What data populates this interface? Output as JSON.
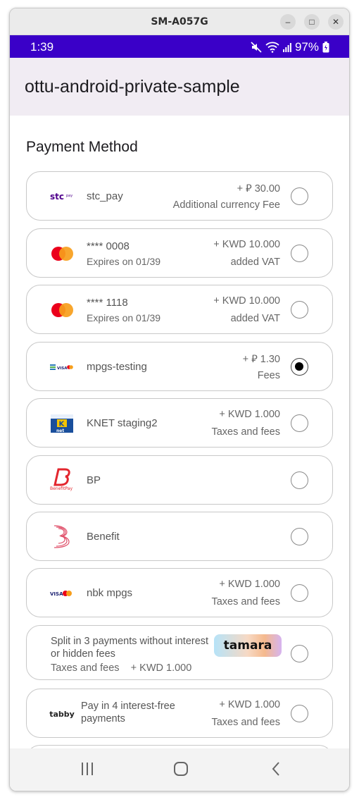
{
  "window": {
    "title": "SM-A057G",
    "minimize": "–",
    "maximize": "□",
    "close": "✕"
  },
  "status": {
    "time": "1:39",
    "battery": "97%"
  },
  "app": {
    "title": "ottu-android-private-sample"
  },
  "section_title": "Payment Method",
  "methods": [
    {
      "name": "stc_pay",
      "logo_text": "stc pay",
      "price": "+ ⃁ 30.00",
      "fee_label": "Additional currency Fee",
      "selected": false
    },
    {
      "name": "**** 0008",
      "sub": "Expires on 01/39",
      "price": "+ KWD 10.000",
      "fee_label": "added VAT",
      "selected": false
    },
    {
      "name": "**** 1118",
      "sub": "Expires on 01/39",
      "price": "+ KWD 10.000",
      "fee_label": "added VAT",
      "selected": false
    },
    {
      "name": "mpgs-testing",
      "logo_text": "VISA",
      "price": "+ ⃁ 1.30",
      "fee_label": "Fees",
      "selected": true
    },
    {
      "name": "KNET  staging2",
      "logo_text": "net",
      "price": "+ KWD 1.000",
      "fee_label": "Taxes and fees",
      "selected": false
    },
    {
      "name": "BP",
      "logo_text": "BenefitPay",
      "selected": false
    },
    {
      "name": "Benefit",
      "selected": false
    },
    {
      "name": "nbk mpgs",
      "logo_text": "VISA",
      "price": "+ KWD 1.000",
      "fee_label": "Taxes and fees",
      "selected": false
    },
    {
      "name_line1": "Split in 3 payments without interest",
      "name_line2": "or hidden fees",
      "fee_label": "Taxes and fees",
      "price": "+ KWD 1.000",
      "badge": "tamara",
      "selected": false
    },
    {
      "name_line1": "Pay in 4 interest-free",
      "name_line2": "payments",
      "logo_text": "tabby",
      "price": "+ KWD 1.000",
      "fee_label": "Taxes and fees",
      "selected": false
    }
  ],
  "colors": {
    "status_bar": "#3a00c8",
    "app_bar": "#f1ecf3",
    "card_border": "#c8c8c8"
  }
}
